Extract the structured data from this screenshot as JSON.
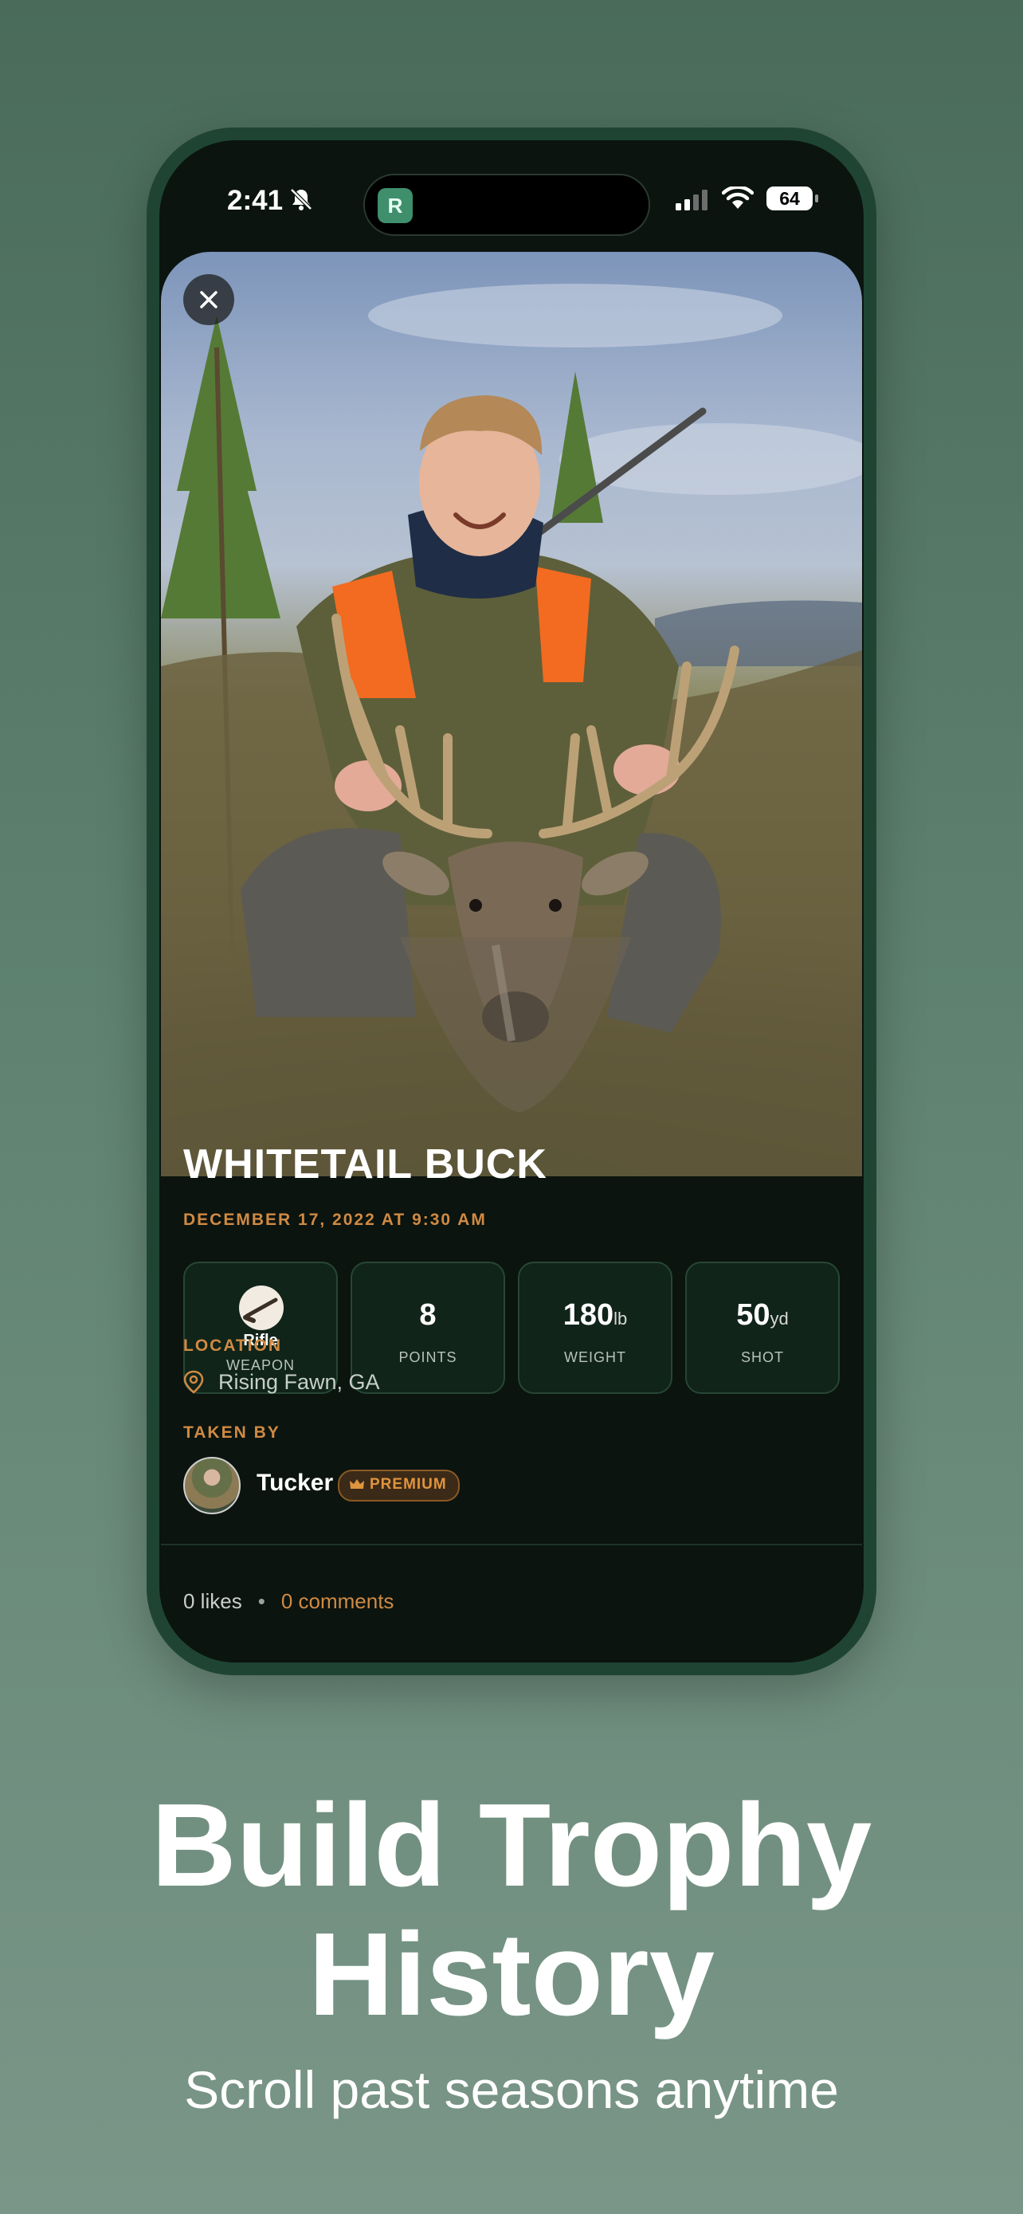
{
  "status_bar": {
    "time": "2:41",
    "battery": "64",
    "app_badge": "R"
  },
  "trophy": {
    "title": "WHITETAIL BUCK",
    "date": "DECEMBER 17, 2022 AT 9:30 AM",
    "stats": [
      {
        "value": "Rifle",
        "label": "WEAPON"
      },
      {
        "value": "8",
        "unit": "",
        "label": "POINTS"
      },
      {
        "value": "180",
        "unit": "lb",
        "label": "WEIGHT"
      },
      {
        "value": "50",
        "unit": "yd",
        "label": "SHOT"
      }
    ],
    "location_label": "LOCATION",
    "location": "Rising Fawn, GA",
    "taken_by_label": "TAKEN BY",
    "taker_name": "Tucker",
    "premium_badge": "PREMIUM",
    "likes": "0 likes",
    "comments": "0 comments"
  },
  "promo": {
    "headline_line1": "Build Trophy",
    "headline_line2": "History",
    "subheadline": "Scroll past seasons anytime"
  },
  "colors": {
    "accent": "#d08a43",
    "background": "#5f8270",
    "phone_frame": "#1f4433"
  }
}
